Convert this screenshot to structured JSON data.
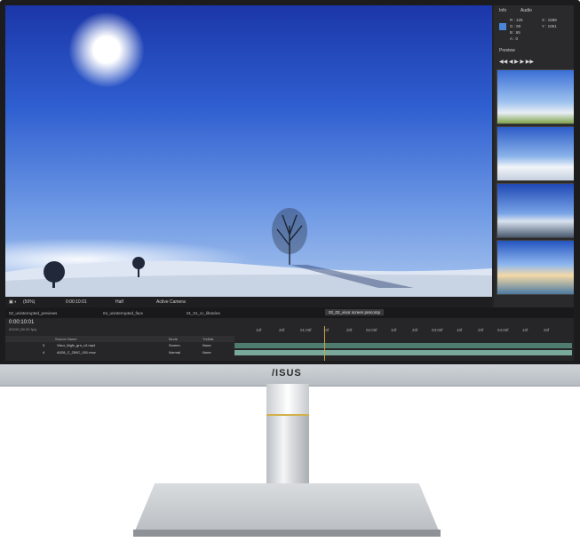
{
  "brand": "/ISUS",
  "viewer": {
    "zoom": "(50%)",
    "timecode": "0:00:10:01",
    "resolution": "Half",
    "camera": "Active Camera"
  },
  "panel": {
    "tab_info": "Info",
    "tab_audio": "Audio",
    "color_r": "R : 125",
    "color_g": "G : 80",
    "color_b": "B : 65",
    "color_a": "A : 0",
    "coord_x": "X : 1588",
    "coord_y": "Y : 1061",
    "preview_label": "Preview",
    "controls": "◀◀ ◀ ▶ ▶ ▶▶"
  },
  "timeline": {
    "tabs": [
      "02_uninterrupted_previews",
      "04_uninterrupted_face",
      "01_01_cc_libraries",
      "02_02_visor screen precomp"
    ],
    "time": "0:00:10:01",
    "fps": "00240 (30.00 fps)",
    "ruler": [
      "10f",
      "20f",
      "01:00f",
      "10f",
      "20f",
      "02:00f",
      "10f",
      "20f",
      "03:00f",
      "10f",
      "20f",
      "04:00f",
      "10f",
      "20f"
    ],
    "header": {
      "source": "Source Name",
      "mode": "Mode",
      "trkmat": "TrkMat"
    },
    "layers": [
      {
        "num": "3",
        "name": "Visor_Mgfx_grn_v3.mp4",
        "mode": "Screen",
        "trkmat": "None"
      },
      {
        "num": "4",
        "name": "A028_C_259C_001.mov",
        "mode": "Normal",
        "trkmat": "None"
      }
    ]
  },
  "colors": {
    "accent": "#79a99a",
    "sky": "#2f5fd0"
  }
}
